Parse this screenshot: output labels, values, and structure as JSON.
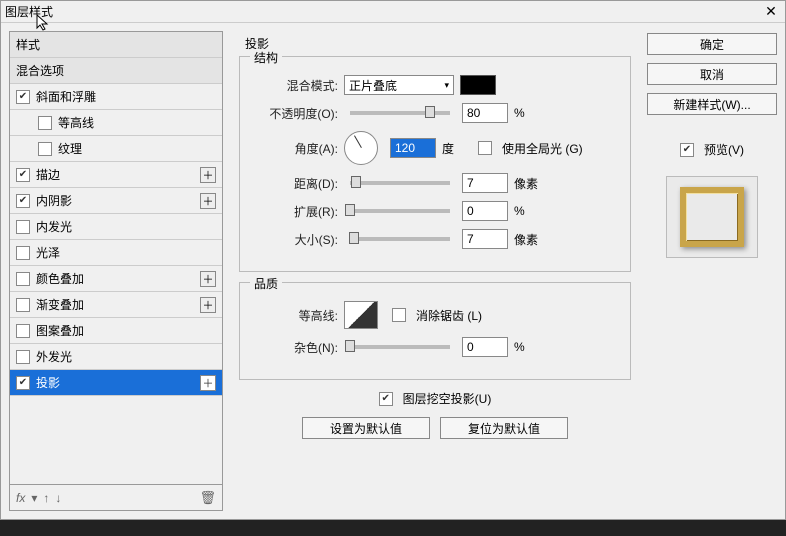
{
  "title": "图层样式",
  "sidebar": {
    "styles": "样式",
    "blend": "混合选项",
    "items": [
      {
        "label": "斜面和浮雕",
        "checked": true,
        "hasPlus": false
      },
      {
        "label": "等高线",
        "checked": false,
        "indent": true
      },
      {
        "label": "纹理",
        "checked": false,
        "indent": true
      },
      {
        "label": "描边",
        "checked": true,
        "hasPlus": true
      },
      {
        "label": "内阴影",
        "checked": true,
        "hasPlus": true
      },
      {
        "label": "内发光",
        "checked": false
      },
      {
        "label": "光泽",
        "checked": false
      },
      {
        "label": "颜色叠加",
        "checked": false,
        "hasPlus": true
      },
      {
        "label": "渐变叠加",
        "checked": false,
        "hasPlus": true
      },
      {
        "label": "图案叠加",
        "checked": false
      },
      {
        "label": "外发光",
        "checked": false
      },
      {
        "label": "投影",
        "checked": true,
        "hasPlus": true,
        "selected": true
      }
    ],
    "fx": "fx"
  },
  "center": {
    "title": "投影",
    "structure": {
      "legend": "结构",
      "blendMode": {
        "label": "混合模式:",
        "value": "正片叠底"
      },
      "opacity": {
        "label": "不透明度(O):",
        "value": "80",
        "unit": "%",
        "thumb": 80
      },
      "angle": {
        "label": "角度(A):",
        "value": "120",
        "unit": "度"
      },
      "globalLight": {
        "label": "使用全局光 (G)",
        "checked": false
      },
      "distance": {
        "label": "距离(D):",
        "value": "7",
        "unit": "像素",
        "thumb": 6
      },
      "spread": {
        "label": "扩展(R):",
        "value": "0",
        "unit": "%",
        "thumb": 0
      },
      "size": {
        "label": "大小(S):",
        "value": "7",
        "unit": "像素",
        "thumb": 4
      }
    },
    "quality": {
      "legend": "品质",
      "contour": {
        "label": "等高线:"
      },
      "antialias": {
        "label": "消除锯齿 (L)",
        "checked": false
      },
      "noise": {
        "label": "杂色(N):",
        "value": "0",
        "unit": "%",
        "thumb": 0
      }
    },
    "knockout": {
      "label": "图层挖空投影(U)",
      "checked": true
    },
    "buttons": {
      "default": "设置为默认值",
      "reset": "复位为默认值"
    }
  },
  "right": {
    "ok": "确定",
    "cancel": "取消",
    "newStyle": "新建样式(W)...",
    "preview": {
      "label": "预览(V)",
      "checked": true
    }
  }
}
